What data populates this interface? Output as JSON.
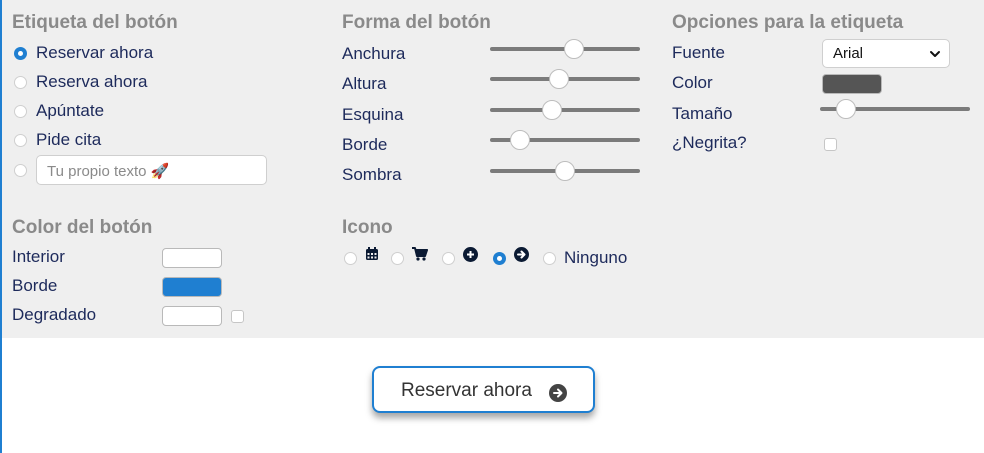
{
  "etiqueta": {
    "heading": "Etiqueta del botón",
    "options": [
      {
        "label": "Reservar ahora",
        "selected": true
      },
      {
        "label": "Reserva ahora",
        "selected": false
      },
      {
        "label": "Apúntate",
        "selected": false
      },
      {
        "label": "Pide cita",
        "selected": false
      }
    ],
    "custom_placeholder": "Tu propio texto 🚀"
  },
  "forma": {
    "heading": "Forma del botón",
    "sliders": [
      {
        "label": "Anchura",
        "value": 0.56
      },
      {
        "label": "Altura",
        "value": 0.46
      },
      {
        "label": "Esquina",
        "value": 0.41
      },
      {
        "label": "Borde",
        "value": 0.2
      },
      {
        "label": "Sombra",
        "value": 0.5
      }
    ]
  },
  "opciones": {
    "heading": "Opciones para la etiqueta",
    "fuente_label": "Fuente",
    "fuente_value": "Arial",
    "color_label": "Color",
    "color_value": "#555555",
    "tamano_label": "Tamaño",
    "tamano_value": 0.17,
    "negrita_label": "¿Negrita?",
    "negrita_checked": false
  },
  "color_boton": {
    "heading": "Color del botón",
    "interior_label": "Interior",
    "interior_color": "#ffffff",
    "borde_label": "Borde",
    "borde_color": "#1f7fd1",
    "degradado_label": "Degradado",
    "degradado_color": "#ffffff",
    "degradado_checked": false
  },
  "icono": {
    "heading": "Icono",
    "options": [
      {
        "icon": "calendar-icon",
        "selected": false
      },
      {
        "icon": "cart-icon",
        "selected": false
      },
      {
        "icon": "plus-circle-icon",
        "selected": false
      },
      {
        "icon": "arrow-right-circle-icon",
        "selected": true
      },
      {
        "label": "Ninguno",
        "selected": false
      }
    ]
  },
  "preview": {
    "label": "Reservar ahora",
    "icon": "arrow-right-circle-icon"
  },
  "colors": {
    "accent": "#1f7fd1",
    "panel_bg": "#efefef",
    "heading": "#8a8a8a",
    "text": "#1d2a5b"
  }
}
